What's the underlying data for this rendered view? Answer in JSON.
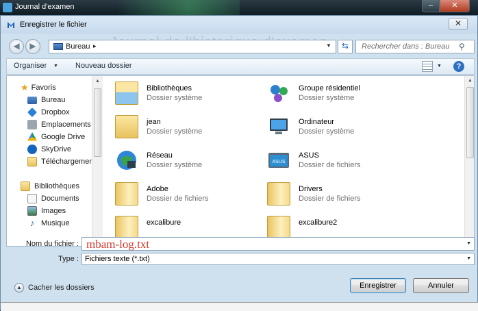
{
  "background_window": {
    "title": "Journal d'examen"
  },
  "dialog": {
    "title": "Enregistrer le fichier",
    "ghost_title": "Journal de l'historique d'examen"
  },
  "address_bar": {
    "location": "Bureau",
    "separator": "▸"
  },
  "search": {
    "placeholder": "Rechercher dans : Bureau"
  },
  "toolbar": {
    "organize_label": "Organiser",
    "new_folder_label": "Nouveau dossier"
  },
  "nav_pane": {
    "favorites_label": "Favoris",
    "favorites": [
      {
        "label": "Bureau",
        "icon": "desktop-icon"
      },
      {
        "label": "Dropbox",
        "icon": "dropbox-icon"
      },
      {
        "label": "Emplacements ré",
        "icon": "recent-places-icon"
      },
      {
        "label": "Google Drive",
        "icon": "google-drive-icon"
      },
      {
        "label": "SkyDrive",
        "icon": "skydrive-icon"
      },
      {
        "label": "Téléchargements",
        "icon": "downloads-icon"
      }
    ],
    "libraries_label": "Bibliothèques",
    "libraries": [
      {
        "label": "Documents",
        "icon": "documents-icon"
      },
      {
        "label": "Images",
        "icon": "images-icon"
      },
      {
        "label": "Musique",
        "icon": "music-icon"
      }
    ]
  },
  "files": [
    {
      "name": "Bibliothèques",
      "type": "Dossier système",
      "icon": "libraries-folder-icon"
    },
    {
      "name": "Groupe résidentiel",
      "type": "Dossier système",
      "icon": "homegroup-icon"
    },
    {
      "name": "jean",
      "type": "Dossier système",
      "icon": "user-folder-icon"
    },
    {
      "name": "Ordinateur",
      "type": "Dossier système",
      "icon": "computer-icon"
    },
    {
      "name": "Réseau",
      "type": "Dossier système",
      "icon": "network-icon"
    },
    {
      "name": "ASUS",
      "type": "Dossier de fichiers",
      "icon": "asus-folder-icon"
    },
    {
      "name": "Adobe",
      "type": "Dossier de fichiers",
      "icon": "folder-icon"
    },
    {
      "name": "Drivers",
      "type": "Dossier de fichiers",
      "icon": "folder-icon"
    },
    {
      "name": "excalibure",
      "type": "",
      "icon": "folder-icon"
    },
    {
      "name": "excalibure2",
      "type": "",
      "icon": "folder-icon"
    }
  ],
  "fields": {
    "filename_label": "Nom du fichier :",
    "filename_value": "mbam-log.txt",
    "type_label": "Type :",
    "type_value": "Fichiers texte (*.txt)"
  },
  "footer": {
    "hide_folders_label": "Cacher les dossiers",
    "save_label": "Enregistrer",
    "cancel_label": "Annuler"
  },
  "colors": {
    "accent": "#2f6fc2",
    "filename_text": "#d9362b",
    "dialog_bg": "#cfe0ef"
  }
}
